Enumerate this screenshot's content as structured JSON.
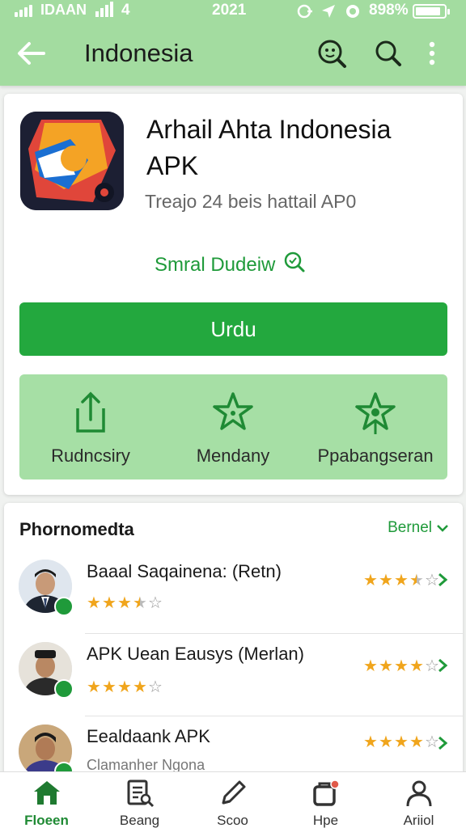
{
  "status_bar": {
    "carrier": "IDAAN",
    "network": "4",
    "time": "2021",
    "battery": "898%"
  },
  "app_bar": {
    "title": "Indonesia",
    "icons": [
      "back-arrow-icon",
      "search-face-icon",
      "search-icon",
      "more-vert-icon"
    ]
  },
  "app": {
    "title": "Arhail Ahta Indonesia APK",
    "subtitle": "Treajo 24 beis hattail AP0",
    "review_link": "Smral Dudeiw",
    "install_label": "Urdu",
    "actions": [
      {
        "label": "Rudncsiry",
        "icon": "share-icon"
      },
      {
        "label": "Mendany",
        "icon": "star-icon"
      },
      {
        "label": "Ppabangseran",
        "icon": "badge-star-icon"
      }
    ]
  },
  "reviews": {
    "title": "Phornomedta",
    "more_label": "Bernel",
    "items": [
      {
        "name": "Baaal Saqainena:  (Retn)",
        "rating": 3.5,
        "right_rating": 3.5
      },
      {
        "name": "APK Uean Eausys (Merlan)",
        "rating": 4,
        "right_rating": 4
      },
      {
        "name": "Eealdaank APK",
        "sub": "Clamanher Ngona",
        "right_rating": 4
      }
    ]
  },
  "bottom_nav": [
    {
      "label": "Floeen",
      "icon": "home-icon",
      "active": true
    },
    {
      "label": "Beang",
      "icon": "document-search-icon",
      "active": false
    },
    {
      "label": "Scoo",
      "icon": "pen-icon",
      "active": false
    },
    {
      "label": "Hpe",
      "icon": "notification-icon",
      "active": false
    },
    {
      "label": "Ariiol",
      "icon": "profile-icon",
      "active": false
    }
  ],
  "colors": {
    "accent": "#23a83e",
    "header": "#a3dca0",
    "star": "#f0a51c"
  }
}
